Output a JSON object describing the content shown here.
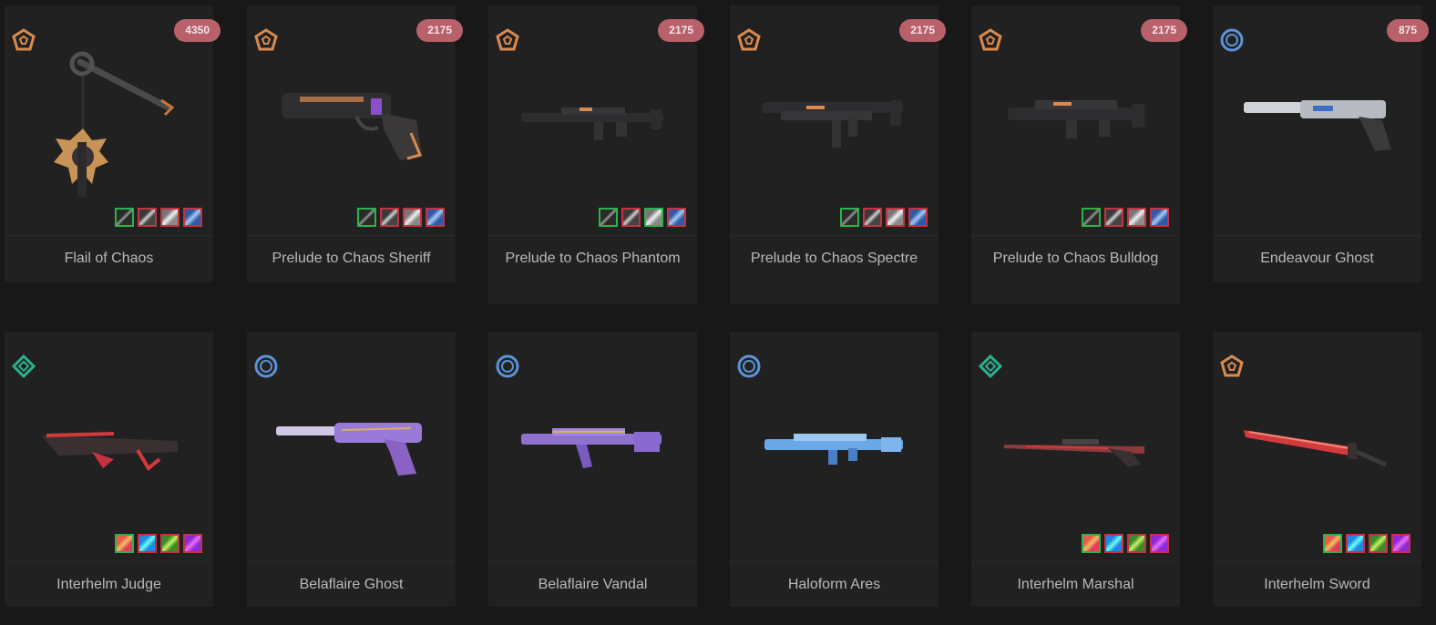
{
  "colors": {
    "page_bg": "#181818",
    "card_bg": "#222121",
    "price_badge_bg": "#b9616b",
    "swatch_selected_border": "#2cb34a",
    "swatch_border": "#c6323f",
    "tier_premium": "#d98b4e",
    "tier_deluxe": "#2bb08e",
    "tier_select": "#5b93d6"
  },
  "cards": [
    {
      "name": "Flail of Chaos",
      "price": "4350",
      "tier_icon": "premium-tier-icon",
      "swatch_count": 4
    },
    {
      "name": "Prelude to Chaos Sheriff",
      "price": "2175",
      "tier_icon": "premium-tier-icon",
      "swatch_count": 4
    },
    {
      "name": "Prelude to Chaos Phantom",
      "price": "2175",
      "tier_icon": "premium-tier-icon",
      "swatch_count": 4
    },
    {
      "name": "Prelude to Chaos Spectre",
      "price": "2175",
      "tier_icon": "premium-tier-icon",
      "swatch_count": 4
    },
    {
      "name": "Prelude to Chaos Bulldog",
      "price": "2175",
      "tier_icon": "premium-tier-icon",
      "swatch_count": 4
    },
    {
      "name": "Endeavour Ghost",
      "price": "875",
      "tier_icon": "select-tier-icon",
      "swatch_count": 0
    },
    {
      "name": "Interhelm Judge",
      "price": "",
      "tier_icon": "deluxe-tier-icon",
      "swatch_count": 4
    },
    {
      "name": "Belaflaire Ghost",
      "price": "",
      "tier_icon": "select-tier-icon",
      "swatch_count": 0
    },
    {
      "name": "Belaflaire Vandal",
      "price": "",
      "tier_icon": "select-tier-icon",
      "swatch_count": 0
    },
    {
      "name": "Haloform Ares",
      "price": "",
      "tier_icon": "select-tier-icon",
      "swatch_count": 0
    },
    {
      "name": "Interhelm Marshal",
      "price": "",
      "tier_icon": "deluxe-tier-icon",
      "swatch_count": 4
    },
    {
      "name": "Interhelm Sword",
      "price": "",
      "tier_icon": "premium-tier-icon",
      "swatch_count": 4
    }
  ]
}
